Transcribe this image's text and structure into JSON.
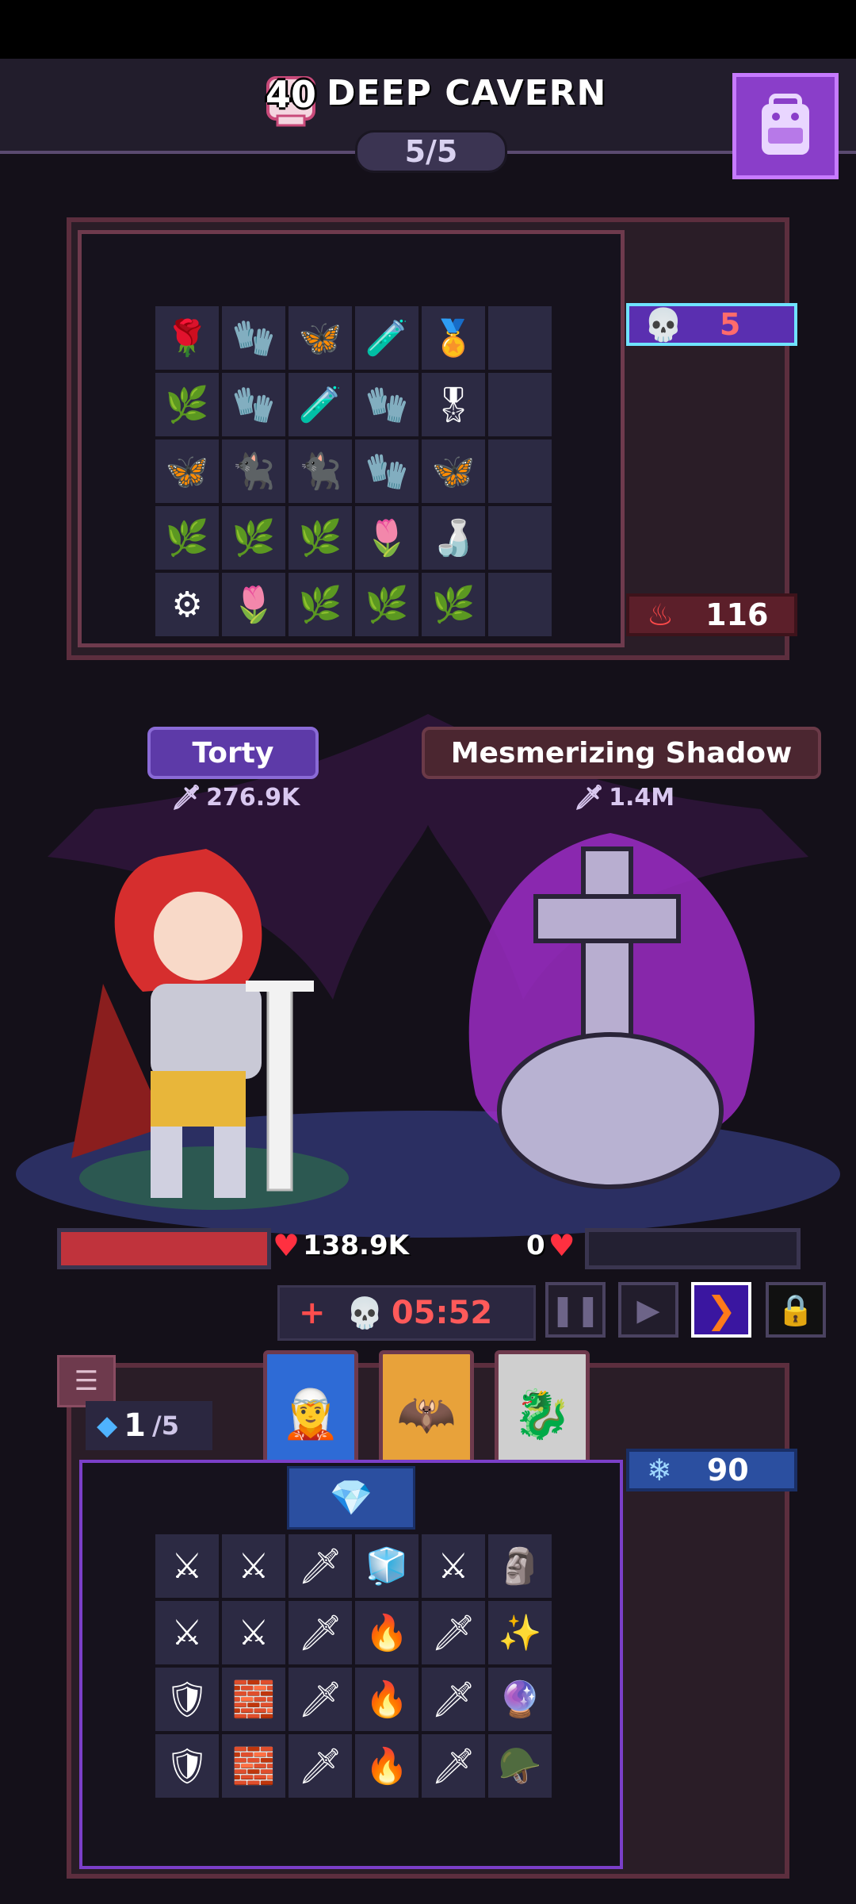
{
  "header": {
    "level": "40",
    "location": "DEEP CAVERN",
    "wave": "5/5",
    "bag_icon": "backpack-icon"
  },
  "enemy_loot": {
    "kill_count": "5",
    "gold": "116",
    "items": [
      "🌹",
      "🧤",
      "🦋",
      "🧪",
      "🏅",
      "",
      "🌿",
      "🧤",
      "🧪",
      "🧤",
      "🎖",
      "",
      "🦋",
      "🐈‍⬛",
      "🐈‍⬛",
      "🧤",
      "🦋",
      "",
      "🌿",
      "🌿",
      "🌿",
      "🌷",
      "🍶",
      "",
      "⚙",
      "🌷",
      "🌿",
      "🌿",
      "🌿",
      ""
    ]
  },
  "player": {
    "name": "Torty",
    "power": "276.9K",
    "hp": "138.9K"
  },
  "enemy": {
    "name": "Mesmerizing Shadow",
    "power": "1.4M",
    "hp": "0"
  },
  "timer": {
    "plus": "+",
    "value": "05:52"
  },
  "controls": [
    "pause-button",
    "play-button",
    "fast-forward-button",
    "locked-speed-button"
  ],
  "player_loot": {
    "gems": "1",
    "gems_max": "/5",
    "shards": "90",
    "items": [
      "⚔",
      "⚔",
      "🗡",
      "🧊",
      "⚔",
      "🗿",
      "⚔",
      "⚔",
      "🗡",
      "🔥",
      "🗡",
      "✨",
      "🛡",
      "🧱",
      "🗡",
      "🔥",
      "🗡",
      "🔮",
      "🛡",
      "🧱",
      "🗡",
      "🔥",
      "🗡",
      "🪖"
    ]
  },
  "colors": {
    "accent_purple": "#8a3ec9",
    "hp_red": "#c0333c",
    "timer_red": "#ff5a5a",
    "gold_tag": "#5c1f2a",
    "blue_tag": "#2b4fa0"
  }
}
